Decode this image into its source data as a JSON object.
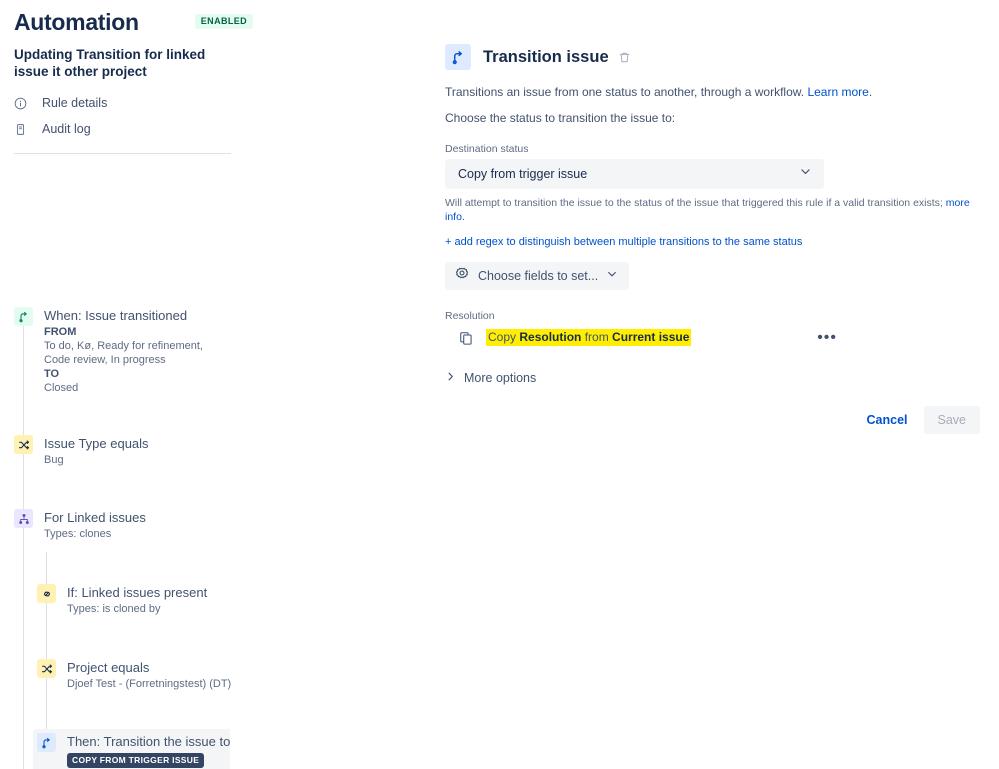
{
  "sidebar": {
    "app_title": "Automation",
    "status_badge": "ENABLED",
    "rule_name": "Updating Transition for linked issue it other project",
    "nav": [
      {
        "label": "Rule details",
        "icon": "info-circle-icon"
      },
      {
        "label": "Audit log",
        "icon": "document-log-icon"
      }
    ],
    "tree": [
      {
        "title": "When: Issue transitioned",
        "from_label": "FROM",
        "from_value": "To do, Kø, Ready for refinement, Code review, In progress",
        "to_label": "TO",
        "to_value": "Closed",
        "icon": "transition-icon",
        "badge_color": "green"
      },
      {
        "title": "Issue Type equals",
        "sub": "Bug",
        "icon": "shuffle-icon",
        "badge_color": "yellow"
      },
      {
        "title": "For Linked issues",
        "sub": "Types: clones",
        "icon": "branch-icon",
        "badge_color": "purple"
      },
      {
        "title": "If: Linked issues present",
        "sub": "Types: is cloned by",
        "icon": "link-icon",
        "badge_color": "yellow"
      },
      {
        "title": "Project equals",
        "sub": "Djoef Test - (Forretningstest) (DT)",
        "icon": "shuffle-icon",
        "badge_color": "yellow"
      },
      {
        "title": "Then: Transition the issue to",
        "lozenge": "COPY FROM TRIGGER ISSUE",
        "icon": "transition-icon",
        "badge_color": "blue",
        "selected": true
      }
    ]
  },
  "main": {
    "icon": "transition-icon",
    "title": "Transition issue",
    "delete_icon": "trash-icon",
    "description": "Transitions an issue from one status to another, through a workflow.",
    "learn_more": "Learn more",
    "prompt": "Choose the status to transition the issue to:",
    "destination": {
      "label": "Destination status",
      "value": "Copy from trigger issue",
      "chevron": "chevron-down-icon",
      "helper": "Will attempt to transition the issue to the status of the issue that triggered this rule if a valid transition exists;",
      "helper_link": "more info."
    },
    "regex_link": "+ add regex to distinguish between multiple transitions to the same status",
    "choose_fields": {
      "icon": "gear-icon",
      "label": "Choose fields to set...",
      "chevron": "chevron-down-icon"
    },
    "resolution": {
      "label": "Resolution",
      "icon": "copy-icon",
      "text_prefix": "Copy ",
      "field": "Resolution",
      "text_middle": " from ",
      "source": "Current issue",
      "overflow": "•••"
    },
    "more_options": {
      "chevron": "chevron-right-icon",
      "label": "More options"
    },
    "cancel_label": "Cancel",
    "save_label": "Save"
  },
  "colors": {
    "accent": "#0052cc",
    "text": "#172b4d",
    "subtle": "#5e6c84",
    "enabled_bg": "#e3fcef",
    "enabled_fg": "#006644",
    "highlight": "#ffee00",
    "lozenge_dark": "#344563"
  }
}
